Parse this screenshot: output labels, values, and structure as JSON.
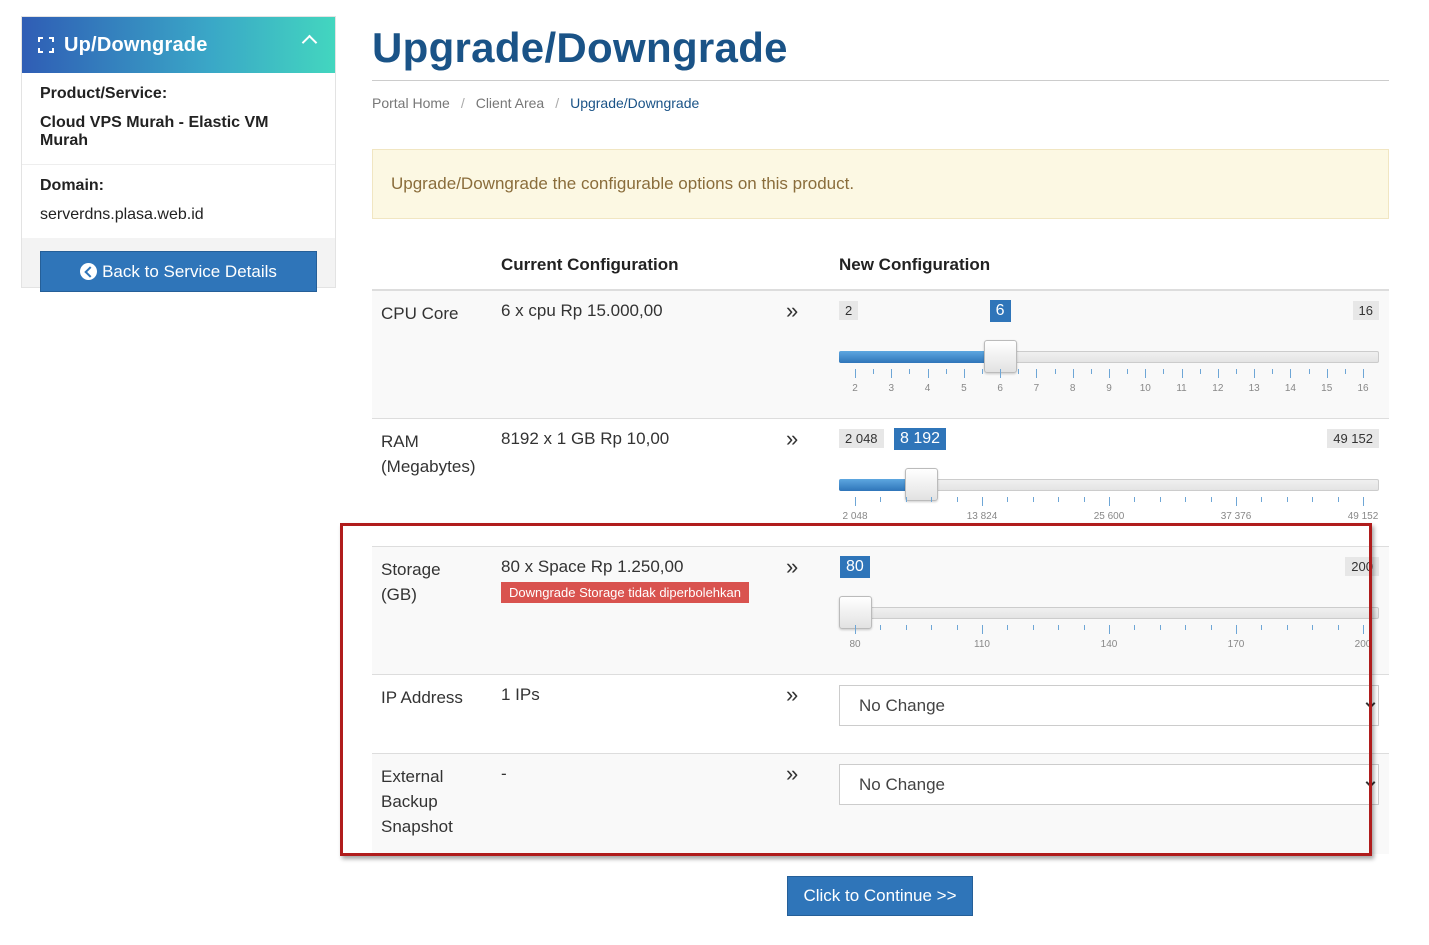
{
  "sidebar": {
    "title": "Up/Downgrade",
    "product_label": "Product/Service:",
    "product_value": "Cloud VPS Murah - Elastic VM Murah",
    "domain_label": "Domain:",
    "domain_value": "serverdns.plasa.web.id",
    "back_button": "Back to Service Details"
  },
  "page": {
    "title": "Upgrade/Downgrade",
    "breadcrumb": [
      "Portal Home",
      "Client Area",
      "Upgrade/Downgrade"
    ],
    "alert": "Upgrade/Downgrade the configurable options on this product."
  },
  "table": {
    "current_header": "Current Configuration",
    "new_header": "New Configuration",
    "arrow": "»",
    "rows": {
      "cpu": {
        "label": "CPU Core",
        "current": "6 x cpu Rp 15.000,00",
        "min": "2",
        "max": "16",
        "value_label": "6",
        "min_num": 2,
        "max_num": 16,
        "value": 6,
        "ticks": [
          "2",
          "3",
          "4",
          "5",
          "6",
          "7",
          "8",
          "9",
          "10",
          "11",
          "12",
          "13",
          "14",
          "15",
          "16"
        ]
      },
      "ram": {
        "label": "RAM (Megabytes)",
        "current": "8192 x 1 GB Rp 10,00",
        "min": "2 048",
        "max": "49 152",
        "value_label": "8 192",
        "min_num": 2048,
        "max_num": 49152,
        "value": 8192,
        "ticks": [
          "2 048",
          "13 824",
          "25 600",
          "37 376",
          "49 152"
        ]
      },
      "storage": {
        "label": "Storage (GB)",
        "current": "80 x Space Rp 1.250,00",
        "error": "Downgrade Storage tidak diperbolehkan",
        "min": "80",
        "max": "200",
        "value_label": "80",
        "min_num": 80,
        "max_num": 200,
        "value": 80,
        "ticks": [
          "80",
          "110",
          "140",
          "170",
          "200"
        ]
      },
      "ip": {
        "label": "IP Address",
        "current": "1 IPs",
        "selected": "No Change"
      },
      "backup": {
        "label": "External Backup Snapshot",
        "current": "-",
        "selected": "No Change"
      }
    }
  },
  "continue_button": "Click to Continue >>",
  "colors": {
    "accent": "#2f75b9",
    "title": "#1a5387",
    "error": "#d9534f",
    "highlight": "#b01c1c"
  }
}
